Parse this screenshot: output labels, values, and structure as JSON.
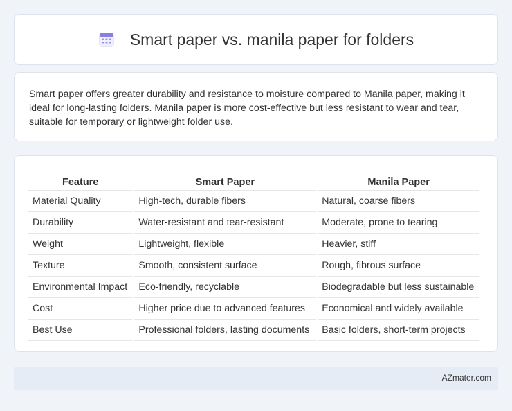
{
  "header": {
    "title": "Smart paper vs. manila paper for folders",
    "icon": "calendar-icon"
  },
  "summary": {
    "text": "Smart paper offers greater durability and resistance to moisture compared to Manila paper, making it ideal for long-lasting folders. Manila paper is more cost-effective but less resistant to wear and tear, suitable for temporary or lightweight folder use."
  },
  "table": {
    "headers": [
      "Feature",
      "Smart Paper",
      "Manila Paper"
    ],
    "rows": [
      [
        "Material Quality",
        "High-tech, durable fibers",
        "Natural, coarse fibers"
      ],
      [
        "Durability",
        "Water-resistant and tear-resistant",
        "Moderate, prone to tearing"
      ],
      [
        "Weight",
        "Lightweight, flexible",
        "Heavier, stiff"
      ],
      [
        "Texture",
        "Smooth, consistent surface",
        "Rough, fibrous surface"
      ],
      [
        "Environmental Impact",
        "Eco-friendly, recyclable",
        "Biodegradable but less sustainable"
      ],
      [
        "Cost",
        "Higher price due to advanced features",
        "Economical and widely available"
      ],
      [
        "Best Use",
        "Professional folders, lasting documents",
        "Basic folders, short-term projects"
      ]
    ]
  },
  "footer": {
    "site": "AZmater.com"
  },
  "colors": {
    "background": "#f0f3f8",
    "card": "#ffffff",
    "footer_bg": "#e6ecf5",
    "icon_accent": "#7b6fd6"
  }
}
